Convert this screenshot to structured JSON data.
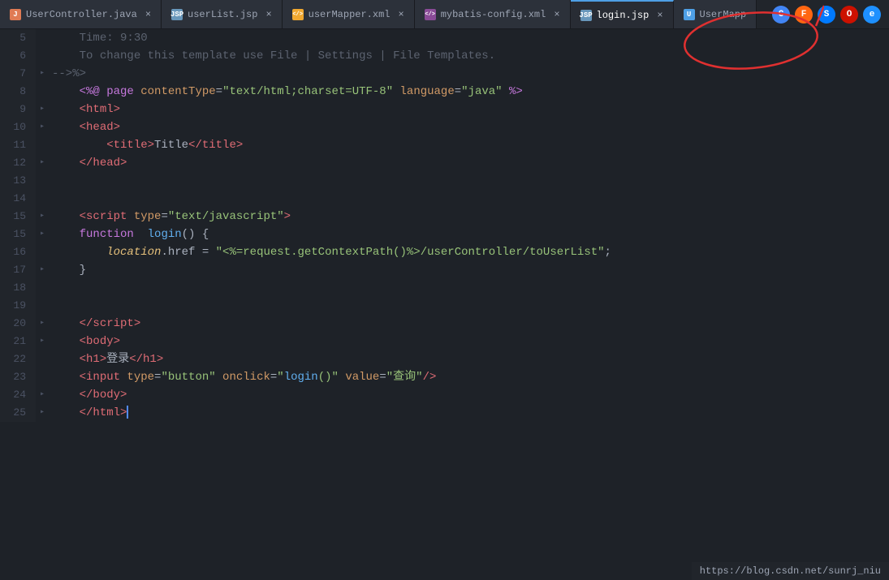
{
  "tabs": [
    {
      "id": "tab-usercontroller",
      "label": "UserController.java",
      "type": "java",
      "active": false
    },
    {
      "id": "tab-userlist",
      "label": "userList.jsp",
      "type": "jsp",
      "active": false
    },
    {
      "id": "tab-usermapper-xml",
      "label": "userMapper.xml",
      "type": "xml-mapper",
      "active": false
    },
    {
      "id": "tab-mybatis-config",
      "label": "mybatis-config.xml",
      "type": "xml-config",
      "active": false
    },
    {
      "id": "tab-login",
      "label": "login.jsp",
      "type": "jsp",
      "active": true
    },
    {
      "id": "tab-usermapp",
      "label": "UserMapp",
      "type": "usermapp",
      "active": false
    }
  ],
  "browser_icons": [
    {
      "id": "chrome",
      "label": "C"
    },
    {
      "id": "firefox",
      "label": "F"
    },
    {
      "id": "safari",
      "label": "S"
    },
    {
      "id": "opera",
      "label": "O"
    },
    {
      "id": "ie",
      "label": "e"
    }
  ],
  "code_lines": [
    {
      "num": "5",
      "fold": "",
      "content_html": "    <span class='c-gray'>Time: 9:30</span>"
    },
    {
      "num": "6",
      "fold": "",
      "content_html": "    <span class='c-gray'>To change this template use File | Settings | File Templates.</span>"
    },
    {
      "num": "7",
      "fold": "▸",
      "content_html": "<span class='c-gray'>--&gt;%&gt;</span>"
    },
    {
      "num": "8",
      "fold": "",
      "content_html": "    <span class='c-jsp'>&lt;%@ page </span><span class='c-attr'>contentType</span><span class='c-white'>=</span><span class='c-string'>\"text/html;charset=UTF-8\"</span><span class='c-attr'> language</span><span class='c-white'>=</span><span class='c-string'>\"java\"</span><span class='c-jsp'> %&gt;</span>"
    },
    {
      "num": "9",
      "fold": "▸",
      "content_html": "    <span class='c-tag'>&lt;html&gt;</span>"
    },
    {
      "num": "10",
      "fold": "▸",
      "content_html": "    <span class='c-tag'>&lt;head&gt;</span>"
    },
    {
      "num": "11",
      "fold": "",
      "content_html": "        <span class='c-tag'>&lt;title&gt;</span><span class='c-white'>Title</span><span class='c-tag'>&lt;/title&gt;</span>"
    },
    {
      "num": "12",
      "fold": "▸",
      "content_html": "    <span class='c-tag'>&lt;/head&gt;</span>"
    },
    {
      "num": "13",
      "fold": "",
      "content_html": ""
    },
    {
      "num": "14",
      "fold": "",
      "content_html": ""
    },
    {
      "num": "15",
      "fold": "▸",
      "content_html": "    <span class='c-tag'>&lt;script </span><span class='c-attr'>type</span><span class='c-white'>=</span><span class='c-string'>\"text/javascript\"</span><span class='c-tag'>&gt;</span>"
    },
    {
      "num": "15",
      "fold": "▸",
      "content_html": "    <span class='c-keyword'>function</span>  <span class='c-blue'>login</span><span class='c-white'>() {</span>"
    },
    {
      "num": "16",
      "fold": "",
      "content_html": "        <span class='c-italic c-blue'>location</span><span class='c-white'>.href = </span><span class='c-string'>\"&lt;%=request.getContextPath()%&gt;/userController/toUserList\"</span><span class='c-white'>;</span>"
    },
    {
      "num": "17",
      "fold": "▸",
      "content_html": "    <span class='c-white'>}</span>"
    },
    {
      "num": "18",
      "fold": "",
      "content_html": ""
    },
    {
      "num": "19",
      "fold": "",
      "content_html": ""
    },
    {
      "num": "20",
      "fold": "▸",
      "content_html": "    <span class='c-tag'>&lt;/script&gt;</span>"
    },
    {
      "num": "21",
      "fold": "▸",
      "content_html": "    <span class='c-tag'>&lt;body&gt;</span>"
    },
    {
      "num": "22",
      "fold": "",
      "content_html": "    <span class='c-tag'>&lt;h1&gt;</span><span class='c-white'>登录</span><span class='c-tag'>&lt;/h1&gt;</span>"
    },
    {
      "num": "23",
      "fold": "",
      "content_html": "    <span class='c-tag'>&lt;input </span><span class='c-attr'>type</span><span class='c-white'>=</span><span class='c-string'>\"button\"</span><span class='c-attr'> onclick</span><span class='c-white'>=</span><span class='c-string'>\"<span class='c-blue'>login</span><span class='c-string'>()</span>\"</span><span class='c-attr'> value</span><span class='c-white'>=</span><span class='c-string'>\"查询\"</span><span class='c-tag'>/&gt;</span>"
    },
    {
      "num": "24",
      "fold": "▸",
      "content_html": "    <span class='c-tag'>&lt;/body&gt;</span>"
    },
    {
      "num": "25",
      "fold": "▸",
      "content_html": "    <span class='c-tag'>&lt;/html&gt;</span><span class='cursor'></span>"
    }
  ],
  "status_bar": {
    "url": "https://blog.csdn.net/sunrj_niu"
  },
  "annotation": {
    "label": "active tab annotation"
  }
}
